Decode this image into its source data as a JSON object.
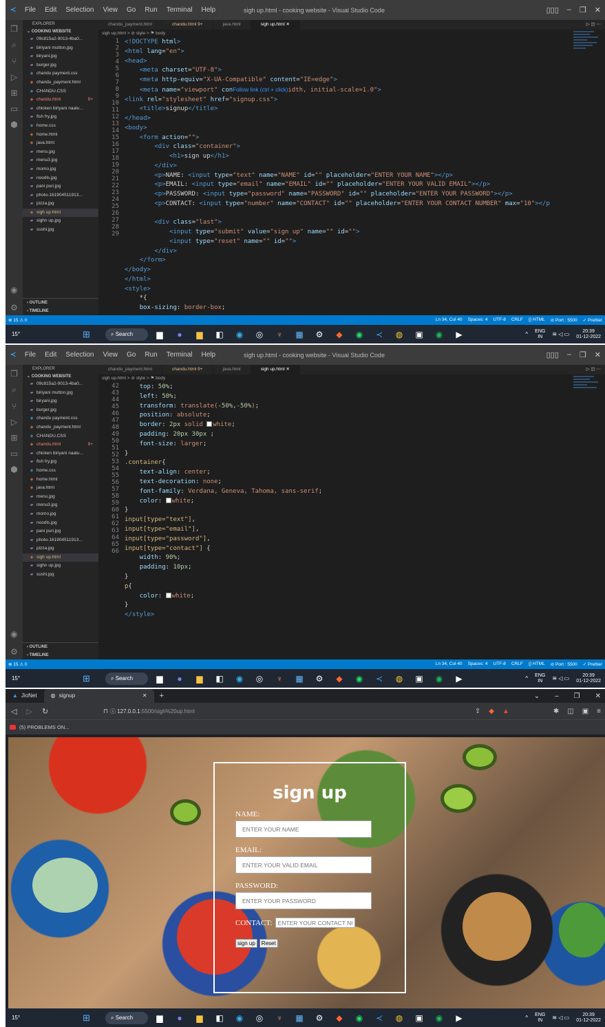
{
  "vscode": {
    "window_title": "sigh up.html - cooking website - Visual Studio Code",
    "menu": [
      "File",
      "Edit",
      "Selection",
      "View",
      "Go",
      "Run",
      "Terminal",
      "Help"
    ],
    "explorer_label": "EXPLORER",
    "folder": "COOKING WEBSITE",
    "files": [
      {
        "name": "09c815a2-9013-4ba0...",
        "type": "img"
      },
      {
        "name": "biriyani mutton.jpg",
        "type": "img"
      },
      {
        "name": "biryani.jpg",
        "type": "img"
      },
      {
        "name": "burger.jpg",
        "type": "img"
      },
      {
        "name": "chandu payment.css",
        "type": "css"
      },
      {
        "name": "chandu_payment.html",
        "type": "html"
      },
      {
        "name": "CHANDU.CSS",
        "type": "css"
      },
      {
        "name": "chandu.html",
        "type": "html",
        "badge": "9+"
      },
      {
        "name": "chicken biriyani naatu...",
        "type": "img"
      },
      {
        "name": "fish fry.jpg",
        "type": "img"
      },
      {
        "name": "home.css",
        "type": "css"
      },
      {
        "name": "home.html",
        "type": "html"
      },
      {
        "name": "java.html",
        "type": "html"
      },
      {
        "name": "menu.jpg",
        "type": "img"
      },
      {
        "name": "menu3.jpg",
        "type": "img"
      },
      {
        "name": "momo.jpg",
        "type": "img"
      },
      {
        "name": "noodls.jpg",
        "type": "img"
      },
      {
        "name": "pani puri.jpg",
        "type": "img"
      },
      {
        "name": "photo-161904511913...",
        "type": "img"
      },
      {
        "name": "pizza.jpg",
        "type": "img"
      },
      {
        "name": "sigh up.html",
        "type": "html",
        "selected": true
      },
      {
        "name": "sighn up.jpg",
        "type": "img"
      },
      {
        "name": "sushi.jpg",
        "type": "img"
      }
    ],
    "outline_label": "OUTLINE",
    "timeline_label": "TIMELINE",
    "tabs": [
      {
        "label": "chandu_payment.html"
      },
      {
        "label": "chandu.html 9+",
        "modified": true
      },
      {
        "label": "java.html"
      },
      {
        "label": "sigh up.html ✕",
        "active": true
      }
    ],
    "breadcrumb": "sigh up.html > ⊘ style > ⚑ body",
    "tooltip": "Follow link (ctrl + click)",
    "status_left": "⊗ 15 ⚠ 0",
    "status_right": [
      "Ln 34, Col 40",
      "Spaces: 4",
      "UTF-8",
      "CRLF",
      "{} HTML",
      "⊘ Port : 5500",
      "✓ Prettier"
    ]
  },
  "taskbar": {
    "temp": "15°",
    "search": "Search",
    "lang": "ENG",
    "region": "IN",
    "time": "20:39",
    "date": "01-12-2022"
  },
  "browser": {
    "tab_other": "JioNet",
    "tab_active": "signup",
    "url_host": "127.0.0.1",
    "url_path": ":5500/sigh%20up.html",
    "bookmark": "(5) PROBLEMS ON..."
  },
  "form": {
    "heading": "sign up",
    "name_label": "NAME:",
    "name_placeholder": "ENTER YOUR NAME",
    "email_label": "EMAIL:",
    "email_placeholder": "ENTER YOUR VALID EMAIL",
    "password_label": "PASSWORD:",
    "password_placeholder": "ENTER YOUR PASSWORD",
    "contact_label": "CONTACT:",
    "contact_placeholder": "ENTER YOUR CONTACT NUMBER",
    "submit": "sign up",
    "reset": "Reset"
  }
}
